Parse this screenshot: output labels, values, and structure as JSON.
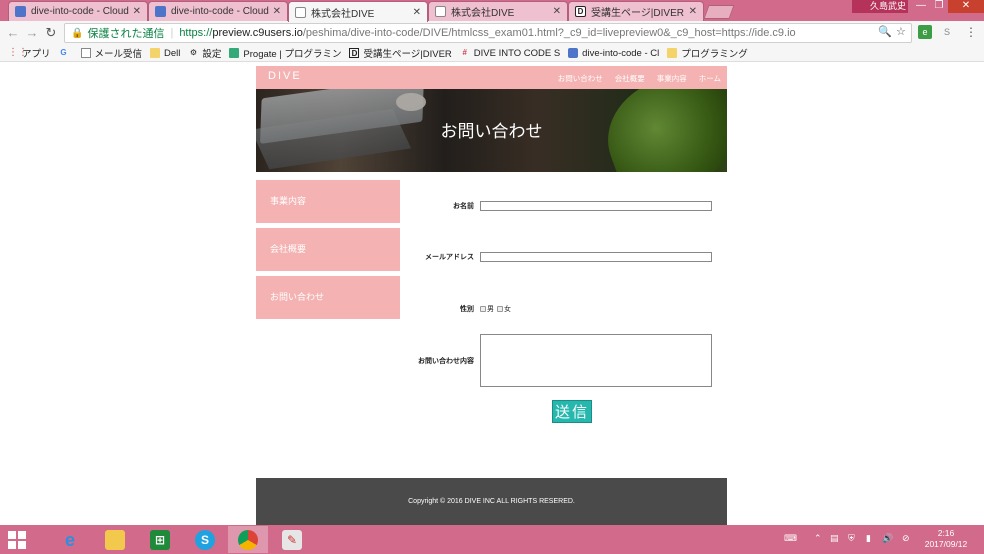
{
  "browser": {
    "tabs": [
      {
        "title": "dive-into-code - Cloud9",
        "icon": "cloud9-icon"
      },
      {
        "title": "dive-into-code - Cloud9",
        "icon": "cloud9-icon"
      },
      {
        "title": "株式会社DIVE",
        "icon": "page-icon"
      },
      {
        "title": "株式会社DIVE",
        "icon": "page-icon"
      },
      {
        "title": "受講生ページ|DIVER",
        "icon": "diver-icon"
      }
    ],
    "user": "久島武史",
    "security_label": "保護された通信",
    "url_proto": "https://",
    "url_host": "preview.c9users.io",
    "url_rest": "/peshima/dive-into-code/DIVE/htmlcss_exam01.html?_c9_id=livepreview0&_c9_host=https://ide.c9.io",
    "bookmarks": [
      {
        "label": "アプリ",
        "icon": "apps-icon"
      },
      {
        "label": "",
        "icon": "google-icon"
      },
      {
        "label": "メール受信",
        "icon": "page-icon"
      },
      {
        "label": "Dell",
        "icon": "folder-icon"
      },
      {
        "label": "設定",
        "icon": "gear-icon"
      },
      {
        "label": "Progate | プログラミン",
        "icon": "progate-icon"
      },
      {
        "label": "受講生ページ|DIVER",
        "icon": "diver-icon"
      },
      {
        "label": "DIVE INTO CODE S",
        "icon": "slack-icon"
      },
      {
        "label": "dive-into-code - Cl",
        "icon": "cloud9-icon"
      },
      {
        "label": "プログラミング",
        "icon": "folder-icon"
      }
    ]
  },
  "site": {
    "logo": "DIVE",
    "nav": [
      "お問い合わせ",
      "会社概要",
      "事業内容",
      "ホーム"
    ],
    "hero_title": "お問い合わせ",
    "sidebar": [
      "事業内容",
      "会社概要",
      "お問い合わせ"
    ],
    "form": {
      "name_label": "お名前",
      "email_label": "メールアドレス",
      "gender_label": "性別",
      "gender_options": [
        "男",
        "女"
      ],
      "message_label": "お問い合わせ内容",
      "submit": "送信"
    },
    "footer": "Copyright © 2016 DIVE INC ALL RIGHTS RESERED."
  },
  "taskbar": {
    "apps": [
      "internet-explorer-icon",
      "file-explorer-icon",
      "store-icon",
      "skype-icon",
      "chrome-icon",
      "paint-icon"
    ],
    "time": "2:16",
    "date": "2017/09/12"
  }
}
